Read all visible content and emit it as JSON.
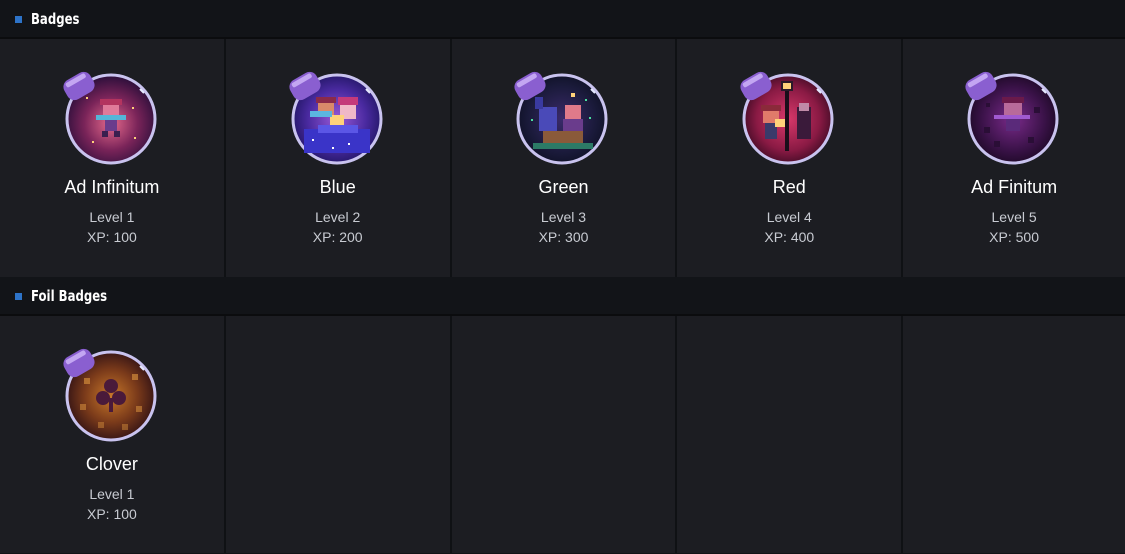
{
  "sections": {
    "badges": {
      "title": "Badges",
      "items": [
        {
          "name": "Ad Infinitum",
          "level": "Level 1",
          "xp": "XP: 100",
          "icon": "ad-infinitum-badge-icon",
          "color": "#c7447a"
        },
        {
          "name": "Blue",
          "level": "Level 2",
          "xp": "XP: 200",
          "icon": "blue-badge-icon",
          "color": "#5b4fd8"
        },
        {
          "name": "Green",
          "level": "Level 3",
          "xp": "XP: 300",
          "icon": "green-badge-icon",
          "color": "#2c7a66"
        },
        {
          "name": "Red",
          "level": "Level 4",
          "xp": "XP: 400",
          "icon": "red-badge-icon",
          "color": "#c42f55"
        },
        {
          "name": "Ad Finitum",
          "level": "Level 5",
          "xp": "XP: 500",
          "icon": "ad-finitum-badge-icon",
          "color": "#7a2f8a"
        }
      ]
    },
    "foil_badges": {
      "title": "Foil Badges",
      "items": [
        {
          "name": "Clover",
          "level": "Level 1",
          "xp": "XP: 100",
          "icon": "clover-badge-icon",
          "color": "#b0622a"
        }
      ]
    }
  },
  "colors": {
    "accent": "#2d73c8",
    "panel": "#1c1d22",
    "header": "#121418"
  }
}
